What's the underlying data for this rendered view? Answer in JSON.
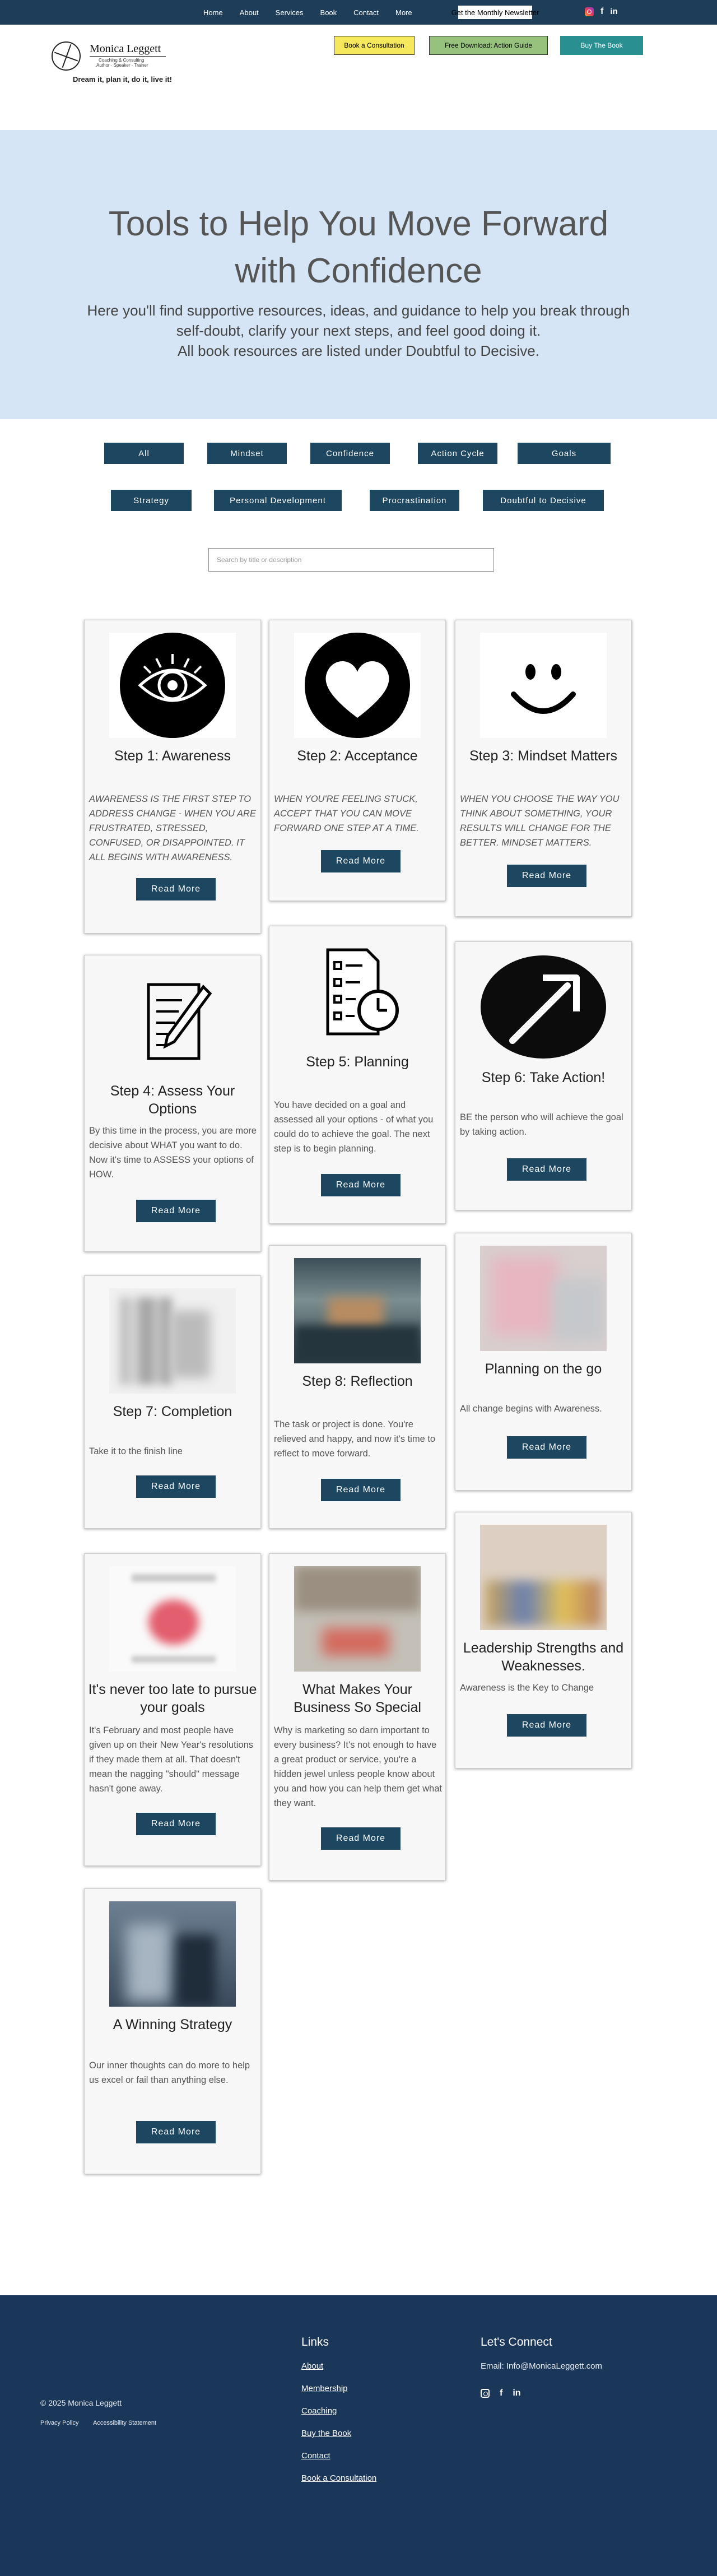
{
  "nav": {
    "items": [
      "Home",
      "About",
      "Services",
      "Book",
      "Contact",
      "More"
    ],
    "newsletter": "Get the Monthly Newsletter"
  },
  "header": {
    "logo_name": "Monica Leggett",
    "logo_sub1": "Coaching & Consulting",
    "logo_sub2": "Author · Speaker · Trainer",
    "tagline": "Dream it, plan it, do it, live it!",
    "buttons": {
      "consult": "Book a Consultation",
      "guide": "Free Download: Action Guide",
      "book": "Buy The Book"
    }
  },
  "hero": {
    "title": "Tools to Help You Move Forward with Confidence",
    "intro": "Here you'll find supportive resources, ideas, and guidance to help you break through self-doubt, clarify your next steps, and feel good doing it.",
    "note": "All book resources are listed under Doubtful to Decisive."
  },
  "filters": [
    "All",
    "Mindset",
    "Confidence",
    "Action Cycle",
    "Goals",
    "Strategy",
    "Personal Development",
    "Procrastination",
    "Doubtful to Decisive"
  ],
  "search": {
    "placeholder": "Search by title or description"
  },
  "cards": [
    {
      "title": "Step 1: Awareness",
      "desc": "AWARENESS IS THE FIRST STEP TO ADDRESS CHANGE - WHEN YOU ARE FRUSTRATED, STRESSED, CONFUSED, OR DISAPPOINTED. IT ALL BEGINS WITH AWARENESS.",
      "button": "Read More",
      "icon": "eye-icon"
    },
    {
      "title": "Step 2: Acceptance",
      "desc": "WHEN YOU'RE FEELING STUCK, ACCEPT THAT YOU CAN MOVE FORWARD ONE STEP AT A TIME.",
      "button": "Read More",
      "icon": "heart-icon"
    },
    {
      "title": "Step 3: Mindset Matters",
      "desc": "WHEN YOU CHOOSE THE WAY YOU THINK ABOUT SOMETHING, YOUR RESULTS WILL CHANGE FOR THE BETTER. MINDSET MATTERS.",
      "button": "Read More",
      "icon": "smiley-icon"
    },
    {
      "title": "Step 4: Assess Your Options",
      "desc": "By this time in the process, you are more decisive about WHAT you want to do. Now it's time to ASSESS your options of HOW.",
      "button": "Read More",
      "icon": "notepad-pencil-icon"
    },
    {
      "title": "Step 5: Planning",
      "desc": "You have decided on a goal and assessed all your options - of what you could do to achieve the goal. The next step is to begin planning.",
      "button": "Read More",
      "icon": "checklist-clock-icon"
    },
    {
      "title": "Step 6: Take Action!",
      "desc": "BE the person who will achieve the goal by taking action.",
      "button": "Read More",
      "icon": "arrow-up-right-icon"
    },
    {
      "title": "Step 7: Completion",
      "desc": "Take it to the finish line",
      "button": "Read More",
      "icon": "completion-photo"
    },
    {
      "title": "Step 8: Reflection",
      "desc": "The task or project is done. You're relieved and happy, and now it's time to reflect to move forward.",
      "button": "Read More",
      "icon": "reflection-photo"
    },
    {
      "title": "Planning on the go",
      "desc": "All change begins with Awareness.",
      "button": "Read More",
      "icon": "planning-photo"
    },
    {
      "title": "It's never too late to pursue your goals",
      "desc": "It's February and most people have given up on their New Year's resolutions if they made them at all. That doesn't mean the nagging \"should\" message hasn't gone away.",
      "button": "Read More",
      "icon": "goals-photo"
    },
    {
      "title": "What Makes Your Business So Special",
      "desc": "Why is marketing so darn important to every business? It's not enough to have a great product or service, you're a hidden jewel unless people know about you and how you can help them get what they want.",
      "button": "Read More",
      "icon": "business-photo"
    },
    {
      "title": "Leadership Strengths and Weaknesses.",
      "desc": "Awareness is the Key to Change",
      "button": "Read More",
      "icon": "leadership-photo"
    },
    {
      "title": "A Winning Strategy",
      "desc": "Our inner thoughts can do more to help us excel or fail than anything else.",
      "button": "Read More",
      "icon": "strategy-photo"
    }
  ],
  "footer": {
    "copyright": "© 2025 Monica Leggett",
    "privacy": "Privacy Policy",
    "accessibility": "Accessibility Statement",
    "links_heading": "Links",
    "links": [
      "About",
      "Membership",
      "Coaching",
      "Buy the Book",
      "Contact",
      "Book a Consultation"
    ],
    "connect_heading": "Let's Connect",
    "email": "Email: Info@MonicaLeggett.com"
  },
  "colors": {
    "navy": "#1d3d59",
    "button": "#1d4660",
    "hero_bg": "#d5e5f5",
    "footer": "#1a3759",
    "yellow": "#f6e85c",
    "green": "#96c27d",
    "teal": "#2a8f91"
  }
}
